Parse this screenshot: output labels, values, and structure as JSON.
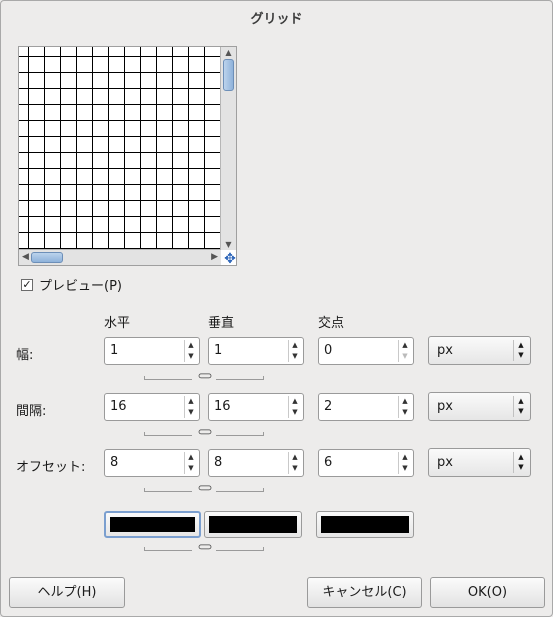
{
  "dialog": {
    "title": "グリッド"
  },
  "preview": {
    "checkbox_label": "プレビュー(P)",
    "checked": true
  },
  "columns": {
    "horizontal": "水平",
    "vertical": "垂直",
    "intersection": "交点"
  },
  "rows": {
    "width": {
      "label": "幅:",
      "horizontal": "1",
      "vertical": "1",
      "intersection": "0",
      "unit": "px"
    },
    "spacing": {
      "label": "間隔:",
      "horizontal": "16",
      "vertical": "16",
      "intersection": "2",
      "unit": "px"
    },
    "offset": {
      "label": "オフセット:",
      "horizontal": "8",
      "vertical": "8",
      "intersection": "6",
      "unit": "px"
    }
  },
  "colors": {
    "horizontal": "#000000",
    "vertical": "#000000",
    "intersection": "#000000"
  },
  "buttons": {
    "help": "ヘルプ(H)",
    "cancel": "キャンセル(C)",
    "ok": "OK(O)"
  }
}
